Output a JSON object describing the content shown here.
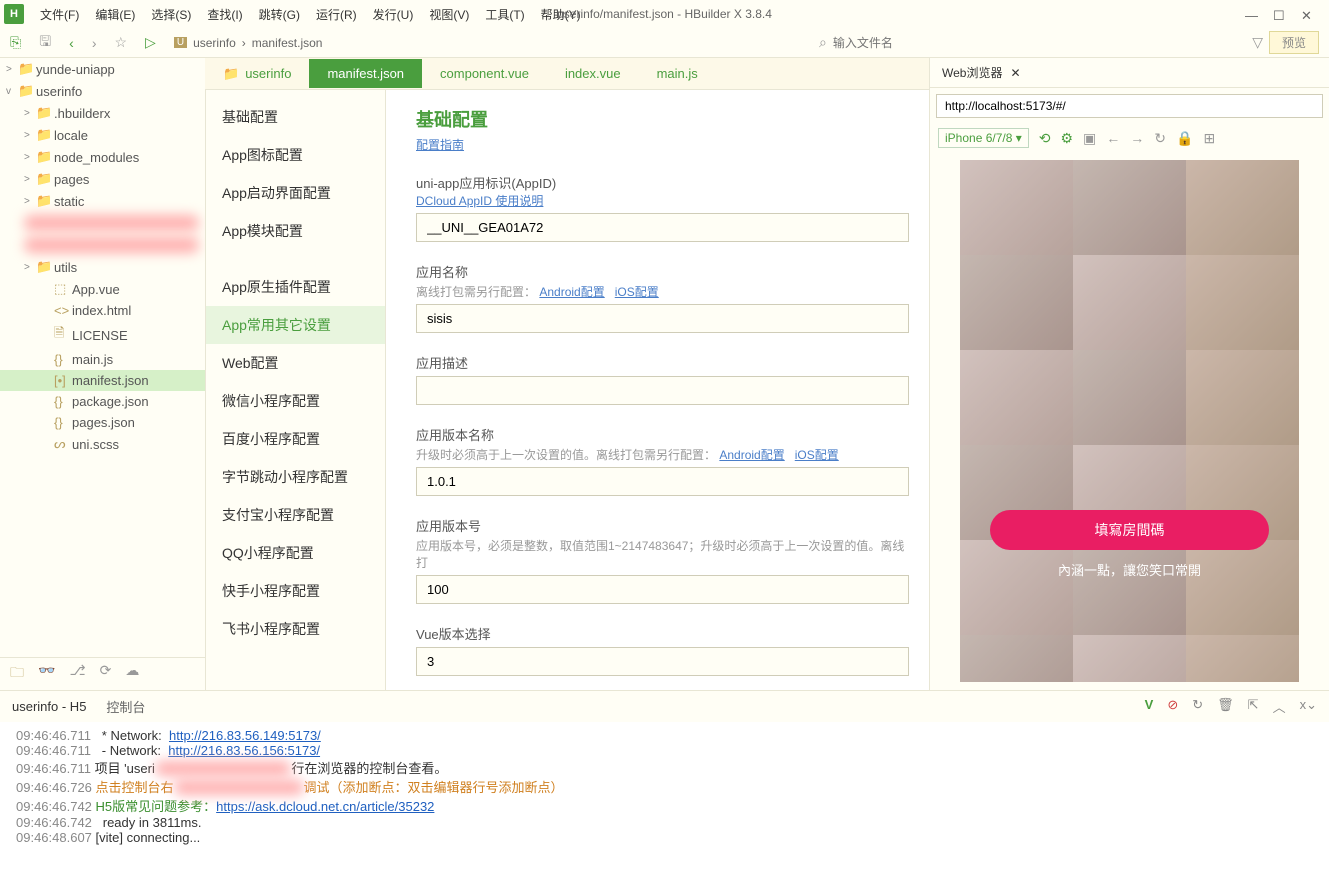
{
  "window": {
    "title": "userinfo/manifest.json - HBuilder X 3.8.4",
    "app_letter": "H"
  },
  "menu": [
    "文件(F)",
    "编辑(E)",
    "选择(S)",
    "查找(I)",
    "跳转(G)",
    "运行(R)",
    "发行(U)",
    "视图(V)",
    "工具(T)",
    "帮助(Y)"
  ],
  "toolbar": {
    "search_placeholder": "输入文件名",
    "preview": "预览"
  },
  "breadcrumb": [
    "userinfo",
    "manifest.json"
  ],
  "tree": [
    {
      "ind": 0,
      "arr": ">",
      "ico": "📁",
      "label": "yunde-uniapp"
    },
    {
      "ind": 0,
      "arr": "v",
      "ico": "📁",
      "label": "userinfo",
      "open": true
    },
    {
      "ind": 1,
      "arr": ">",
      "ico": "📁",
      "label": ".hbuilderx"
    },
    {
      "ind": 1,
      "arr": ">",
      "ico": "📁",
      "label": "locale"
    },
    {
      "ind": 1,
      "arr": ">",
      "ico": "📁",
      "label": "node_modules"
    },
    {
      "ind": 1,
      "arr": ">",
      "ico": "📁",
      "label": "pages"
    },
    {
      "ind": 1,
      "arr": ">",
      "ico": "📁",
      "label": "static"
    },
    {
      "ind": 1,
      "arr": "",
      "ico": "",
      "label": "",
      "blur": true
    },
    {
      "ind": 1,
      "arr": "",
      "ico": "",
      "label": "",
      "blur": true
    },
    {
      "ind": 1,
      "arr": ">",
      "ico": "📁",
      "label": "utils"
    },
    {
      "ind": 2,
      "arr": "",
      "ico": "⬚",
      "label": "App.vue"
    },
    {
      "ind": 2,
      "arr": "",
      "ico": "<>",
      "label": "index.html"
    },
    {
      "ind": 2,
      "arr": "",
      "ico": "🗎",
      "label": "LICENSE"
    },
    {
      "ind": 2,
      "arr": "",
      "ico": "{}",
      "label": "main.js"
    },
    {
      "ind": 2,
      "arr": "",
      "ico": "[•]",
      "label": "manifest.json",
      "sel": true
    },
    {
      "ind": 2,
      "arr": "",
      "ico": "{}",
      "label": "package.json"
    },
    {
      "ind": 2,
      "arr": "",
      "ico": "{}",
      "label": "pages.json"
    },
    {
      "ind": 2,
      "arr": "",
      "ico": "ᔕ",
      "label": "uni.scss"
    }
  ],
  "file_tabs": [
    {
      "ico": "📁",
      "label": "userinfo"
    },
    {
      "label": "manifest.json",
      "active": true
    },
    {
      "label": "component.vue"
    },
    {
      "label": "index.vue"
    },
    {
      "label": "main.js"
    }
  ],
  "config_nav": [
    "基础配置",
    "App图标配置",
    "App启动界面配置",
    "App模块配置",
    "",
    "App原生插件配置",
    "App常用其它设置",
    "Web配置",
    "微信小程序配置",
    "百度小程序配置",
    "字节跳动小程序配置",
    "支付宝小程序配置",
    "QQ小程序配置",
    "快手小程序配置",
    "飞书小程序配置"
  ],
  "config_nav_active": 6,
  "editor": {
    "title": "基础配置",
    "guide": "配置指南",
    "appid_label": "uni-app应用标识(AppID)",
    "appid_link": "DCloud AppID 使用说明",
    "appid_value": "__UNI__GEA01A72",
    "name_label": "应用名称",
    "name_hint_prefix": "离线打包需另行配置：",
    "android_link": "Android配置",
    "ios_link": "iOS配置",
    "name_value": "sisis",
    "desc_label": "应用描述",
    "desc_value": "",
    "ver_label": "应用版本名称",
    "ver_hint": "升级时必须高于上一次设置的值。离线打包需另行配置：",
    "ver_value": "1.0.1",
    "code_label": "应用版本号",
    "code_hint": "应用版本号，必须是整数，取值范围1~2147483647；升级时必须高于上一次设置的值。离线打",
    "code_value": "100",
    "vue_label": "Vue版本选择",
    "vue_value": "3"
  },
  "browser": {
    "tab": "Web浏览器",
    "url": "http://localhost:5173/#/",
    "device": "iPhone 6/7/8",
    "overlay_btn": "填寫房間碼",
    "overlay_text": "內涵一點，讓您笑口常開"
  },
  "console": {
    "tab1": "userinfo - H5",
    "tab2": "控制台",
    "lines": [
      {
        "ts": "09:46:46.711",
        "t": "  * Network:  ",
        "link": "http://216.83.56.149:5173/"
      },
      {
        "ts": "09:46:46.711",
        "t": "  - Network:  ",
        "link": "http://216.83.56.156:5173/"
      },
      {
        "ts": "09:46:46.711",
        "t": "项目 'useri",
        "blur": "xxxxxxxxxxxxxxxxxxxxx",
        "t2": "行在浏览器的控制台查看。"
      },
      {
        "ts": "09:46:46.726",
        "orange": "点击控制台右",
        "blur": "xxxxxxxxxxxxxxxxxxxx",
        "orange2": "调试（添加断点：双击编辑器行号添加断点）"
      },
      {
        "ts": "09:46:46.742",
        "green": "H5版常见问题参考：",
        "link": "https://ask.dcloud.net.cn/article/35232"
      },
      {
        "ts": "09:46:46.742",
        "t": "  ready in 3811ms."
      },
      {
        "ts": "09:46:48.607",
        "t": "[vite] connecting..."
      }
    ]
  }
}
